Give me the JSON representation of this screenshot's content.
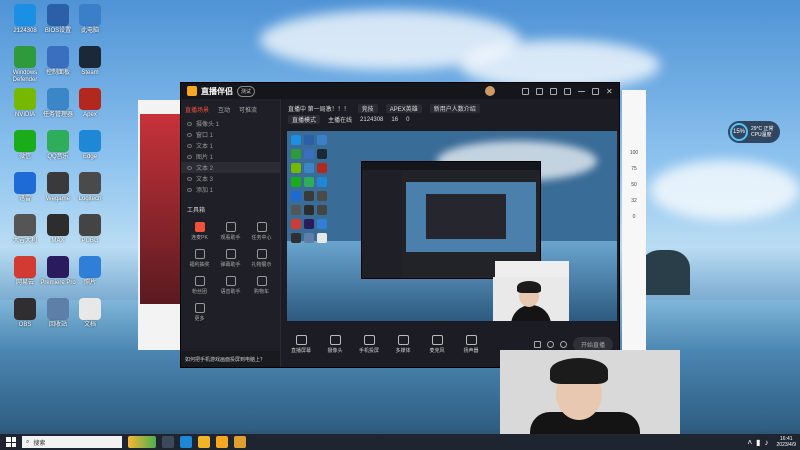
{
  "desktop": {
    "icons": [
      {
        "label": "2124308",
        "color": "#1a8fe3"
      },
      {
        "label": "BIOS设置",
        "color": "#2b5fa8"
      },
      {
        "label": "此电脑",
        "color": "#3c7fc9"
      },
      {
        "label": "Windows Defender",
        "color": "#2e9a3c"
      },
      {
        "label": "控制面板",
        "color": "#3a6fbf"
      },
      {
        "label": "Steam",
        "color": "#1b2838"
      },
      {
        "label": "NVIDIA",
        "color": "#76b900"
      },
      {
        "label": "任务管理器",
        "color": "#3b86c6"
      },
      {
        "label": "Apex",
        "color": "#b3281e"
      },
      {
        "label": "微信",
        "color": "#1aad19"
      },
      {
        "label": "QQ音乐",
        "color": "#2fad5a"
      },
      {
        "label": "Edge",
        "color": "#1e88d6"
      },
      {
        "label": "迅雷",
        "color": "#1e6bd6"
      },
      {
        "label": "Wegame",
        "color": "#3a3a3a"
      },
      {
        "label": "Logitech",
        "color": "#4a4a4a"
      },
      {
        "label": "大吉大利",
        "color": "#555555"
      },
      {
        "label": "MAX",
        "color": "#2d2d2d"
      },
      {
        "label": "PUBG",
        "color": "#444444"
      },
      {
        "label": "网易云",
        "color": "#d33a31"
      },
      {
        "label": "Premiere Pro",
        "color": "#2a1a5e"
      },
      {
        "label": "照片",
        "color": "#2f7fd8"
      },
      {
        "label": "OBS",
        "color": "#302e31"
      },
      {
        "label": "回收站",
        "color": "#5d7fa8"
      },
      {
        "label": "文档",
        "color": "#e8e8e8"
      }
    ]
  },
  "app": {
    "title": "直播伴侣",
    "badge": "测试",
    "tabs": [
      "直播场景",
      "互动",
      "可推流"
    ],
    "scenes": [
      "摄像头 1",
      "窗口 1",
      "文本 1",
      "图片 1",
      "文本 2",
      "文本 3",
      "添加 1"
    ],
    "tools_title": "工具箱",
    "tools": [
      {
        "label": "连麦PK",
        "hot": true
      },
      {
        "label": "观看助手",
        "hot": false
      },
      {
        "label": "任务中心",
        "hot": false
      },
      {
        "label": "福利抽奖",
        "hot": false
      },
      {
        "label": "弹幕助手",
        "hot": false
      },
      {
        "label": "礼物展示",
        "hot": false
      },
      {
        "label": "粉丝团",
        "hot": false
      },
      {
        "label": "语音助手",
        "hot": false
      },
      {
        "label": "购物车",
        "hot": false
      },
      {
        "label": "更多",
        "hot": false
      }
    ],
    "footer_text": "如何把手机游戏画面投屏到电脑上？",
    "info": {
      "title": "直播中 第一局激！！！",
      "category": "竞技",
      "game": "APEX英雄",
      "tag": "新用户人数介绍",
      "mode": "直播模式",
      "camera": "主播在线",
      "uid": "2124308",
      "viewers": "16",
      "likes": "0"
    },
    "bottom_tools": [
      "直播屏幕",
      "摄像头",
      "手机投屏",
      "多媒体",
      "麦克风",
      "扬声器"
    ],
    "start_button": "开始直播"
  },
  "side_panel": {
    "values": [
      "100",
      "75",
      "50",
      "32",
      "0"
    ]
  },
  "cpu_widget": {
    "percent": "15%",
    "line1": "29°C 正常",
    "line2": "CPU温度"
  },
  "taskbar": {
    "search_placeholder": "搜索",
    "time": "16:41",
    "date": "2023/4/9"
  }
}
